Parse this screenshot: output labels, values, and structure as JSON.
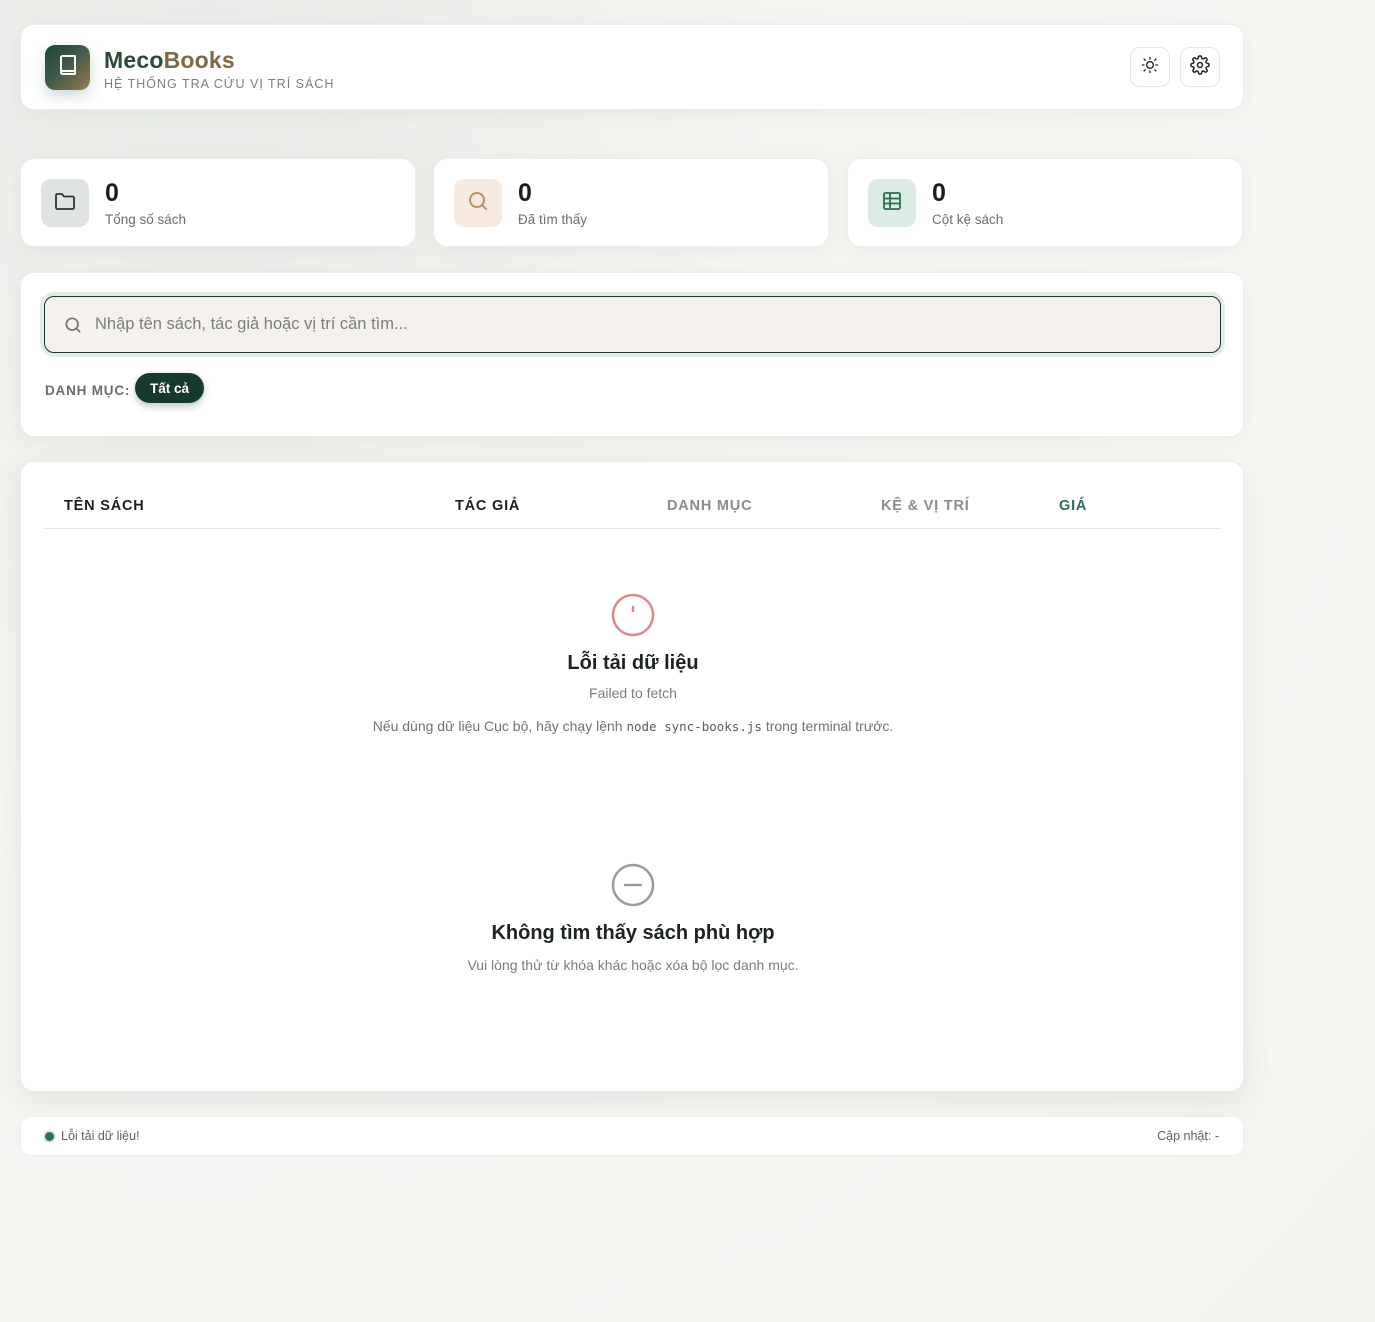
{
  "header": {
    "brand_part1": "Meco",
    "brand_part2": "Books",
    "subtitle": "HỆ THỐNG TRA CỨU VỊ TRÍ SÁCH",
    "logo_icon": "book-icon",
    "theme_icon": "sun-icon",
    "settings_icon": "gear-icon"
  },
  "stats": [
    {
      "value": "0",
      "label": "Tổng số sách",
      "icon": "folder-icon"
    },
    {
      "value": "0",
      "label": "Đã tìm thấy",
      "icon": "search-icon"
    },
    {
      "value": "0",
      "label": "Cột kệ sách",
      "icon": "grid-icon"
    }
  ],
  "search": {
    "placeholder": "Nhập tên sách, tác giả hoặc vị trí cần tìm...",
    "value": ""
  },
  "categories": {
    "label": "DANH MỤC:",
    "items": [
      "Tất cả"
    ],
    "selected": "Tất cả"
  },
  "table": {
    "columns": [
      "TÊN SÁCH",
      "TÁC GIẢ",
      "DANH MỤC",
      "KỆ & VỊ TRÍ",
      "GIÁ"
    ],
    "rows": []
  },
  "error_state": {
    "icon": "alert-circle-icon",
    "title": "Lỗi tải dữ liệu",
    "message": "Failed to fetch",
    "hint_before": "Nếu dùng dữ liệu Cục bộ, hãy chạy lệnh",
    "hint_code": "node sync-books.js",
    "hint_after": "trong terminal trước."
  },
  "empty_state": {
    "icon": "minus-circle-icon",
    "title": "Không tìm thấy sách phù hợp",
    "message": "Vui lòng thử từ khóa khác hoặc xóa bộ lọc danh mục."
  },
  "footer": {
    "status": "Lỗi tải dữ liệu!",
    "updated": "Cập nhật: -"
  },
  "colors": {
    "accent_dark_green": "#163b2c",
    "brand_gold": "#7d6a44",
    "error_red": "#e0898a",
    "price_green": "#2b6d52"
  }
}
